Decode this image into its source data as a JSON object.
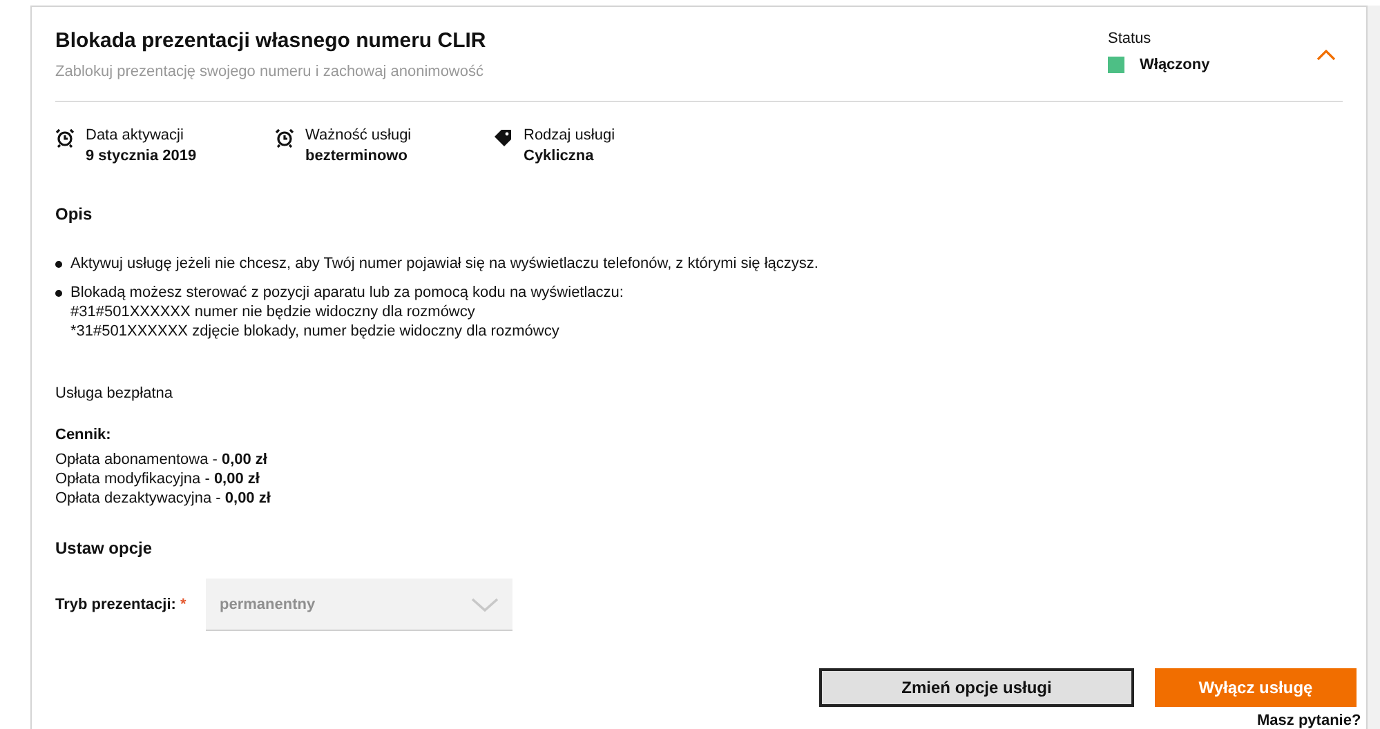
{
  "service": {
    "title": "Blokada prezentacji własnego numeru CLIR",
    "subtitle": "Zablokuj prezentację swojego numeru i zachowaj anonimowość",
    "expanded": true
  },
  "status": {
    "label": "Status",
    "value": "Włączony",
    "color": "#4dbf85"
  },
  "info": [
    {
      "kind": "alarm",
      "label": "Data aktywacji",
      "value": "9 stycznia 2019"
    },
    {
      "kind": "alarm",
      "label": "Ważność usługi",
      "value": "bezterminowo"
    },
    {
      "kind": "tag",
      "label": "Rodzaj usługi",
      "value": "Cykliczna"
    }
  ],
  "description": {
    "heading": "Opis",
    "bullets": [
      [
        "Aktywuj usługę jeżeli nie chcesz, aby Twój numer pojawiał się na wyświetlaczu telefonów, z którymi się łączysz."
      ],
      [
        "Blokadą możesz sterować z pozycji aparatu lub za pomocą kodu na wyświetlaczu:",
        "#31#501XXXXXX numer nie będzie widoczny dla rozmówcy",
        "*31#501XXXXXX zdjęcie blokady, numer będzie widoczny dla rozmówcy"
      ]
    ]
  },
  "free_note": "Usługa bezpłatna",
  "pricing": {
    "heading": "Cennik:",
    "lines": [
      "Opłata abonamentowa - **0,00 zł**",
      "Opłata modyfikacyjna - **0,00 zł**",
      "Opłata dezaktywacyjna - **0,00 zł**"
    ]
  },
  "options": {
    "heading": "Ustaw opcje",
    "field_label": "Tryb prezentacji:",
    "required_mark": "*",
    "select_value": "permanentny",
    "disabled": true
  },
  "buttons": [
    {
      "kind": "secondary",
      "label": "Zmień opcje usługi"
    },
    {
      "kind": "primary",
      "label": "Wyłącz usługę"
    }
  ],
  "help_badge": "Masz pytanie?"
}
